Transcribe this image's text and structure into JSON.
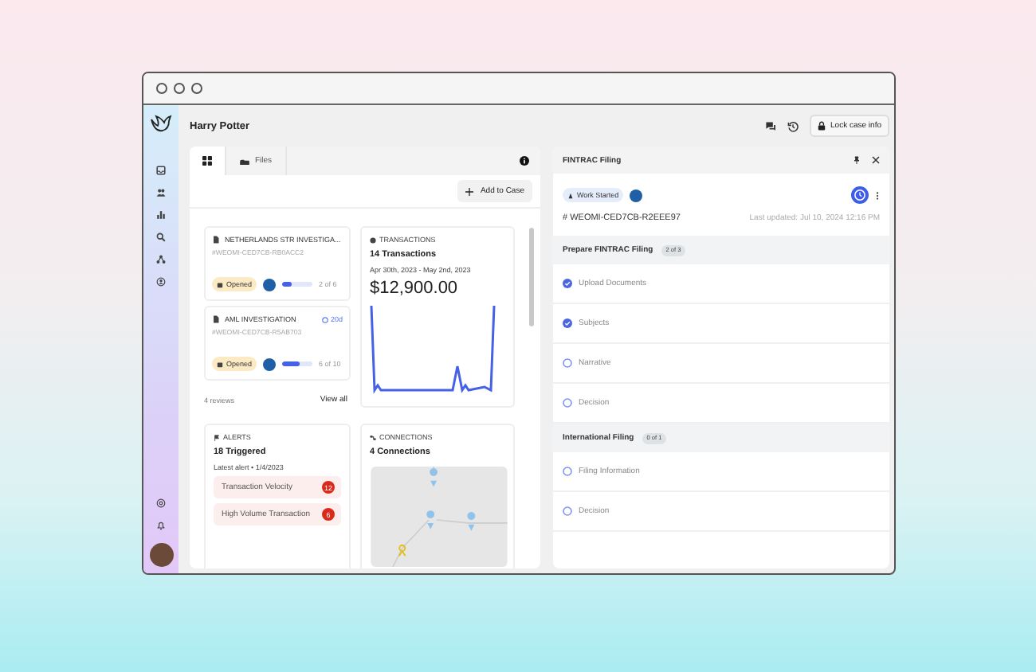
{
  "header": {
    "title": "Harry Potter",
    "lock_button": "Lock case info"
  },
  "left_panel": {
    "tabs": [
      {
        "kind": "grid",
        "selected": true
      },
      {
        "kind": "files",
        "label": "Files",
        "selected": false
      }
    ],
    "add_button": "Add to Case",
    "cases": [
      {
        "title": "NETHERLANDS STR INVESTIGA...",
        "id": "#WEOMI-CED7CB-RB0ACC2",
        "status": "Opened",
        "level": 0.33,
        "progress": "2 of 6"
      },
      {
        "title": "AML INVESTIGATION",
        "due": "20d",
        "id": "#WEOMI-CED7CB-R5AB703",
        "status": "Opened",
        "level": 0.6,
        "progress": "6 of 10"
      }
    ],
    "reviews": "4 reviews",
    "view_all": "View all",
    "transactions": {
      "heading": "TRANSACTIONS",
      "count": "14 Transactions",
      "range": "Apr 30th, 2023 - May 2nd, 2023",
      "amount": "$12,900.00"
    },
    "alerts": {
      "heading": "ALERTS",
      "triggered": "18 Triggered",
      "latest": "Latest alert • 1/4/2023",
      "items": [
        {
          "label": "Transaction Velocity",
          "count": "12"
        },
        {
          "label": "High Volume Transaction",
          "count": "6"
        }
      ]
    },
    "connections": {
      "heading": "CONNECTIONS",
      "count": "4 Connections"
    }
  },
  "right_panel": {
    "title": "FINTRAC Filing",
    "status": "Work Started",
    "case_id": "# WEOMI-CED7CB-R2EEE97",
    "updated": "Last updated: Jul 10, 2024 12:16 PM",
    "sections": [
      {
        "title": "Prepare FINTRAC Filing",
        "badge": "2 of 3",
        "tasks": [
          {
            "label": "Upload Documents",
            "checked": true
          },
          {
            "label": "Subjects",
            "checked": true
          },
          {
            "label": "Narrative",
            "checked": false
          },
          {
            "label": "Decision",
            "checked": false
          }
        ]
      },
      {
        "title": "International Filing",
        "badge": "0 of 1",
        "tasks": [
          {
            "label": "Filing Information",
            "checked": false
          },
          {
            "label": "Decision",
            "checked": false
          }
        ]
      }
    ]
  }
}
